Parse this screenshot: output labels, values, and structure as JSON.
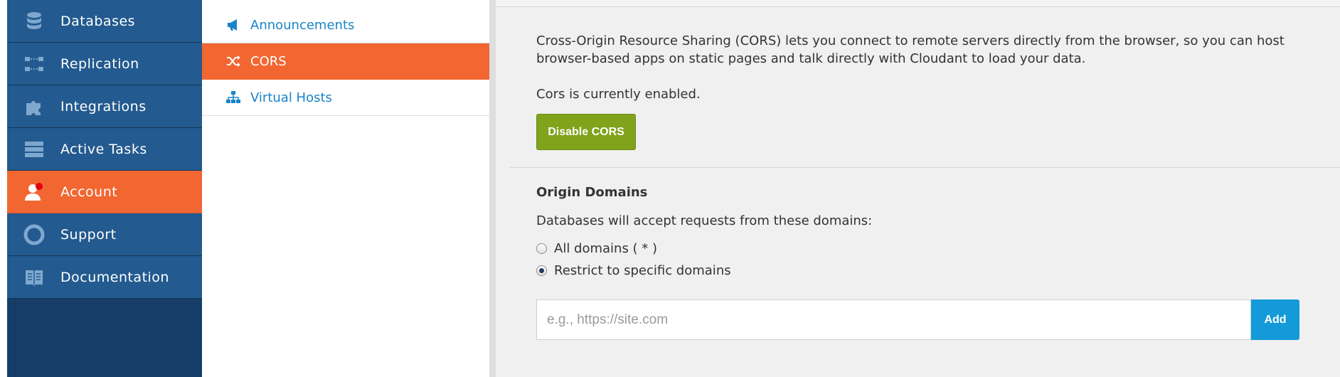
{
  "nav": {
    "items": [
      {
        "label": "Databases",
        "icon": "database-icon"
      },
      {
        "label": "Replication",
        "icon": "replication-icon"
      },
      {
        "label": "Integrations",
        "icon": "puzzle-icon"
      },
      {
        "label": "Active Tasks",
        "icon": "tasks-icon"
      },
      {
        "label": "Account",
        "icon": "user-icon",
        "active": true
      },
      {
        "label": "Support",
        "icon": "lifebuoy-icon"
      },
      {
        "label": "Documentation",
        "icon": "book-icon"
      }
    ]
  },
  "subnav": {
    "items": [
      {
        "label": "Announcements",
        "icon": "megaphone-icon"
      },
      {
        "label": "CORS",
        "icon": "shuffle-icon",
        "active": true
      },
      {
        "label": "Virtual Hosts",
        "icon": "sitemap-icon"
      }
    ]
  },
  "cors": {
    "description": "Cross-Origin Resource Sharing (CORS) lets you connect to remote servers directly from the browser, so you can host browser-based apps on static pages and talk directly with Cloudant to load your data.",
    "status": "Cors is currently enabled.",
    "disable_label": "Disable CORS",
    "origin_title": "Origin Domains",
    "origin_desc": "Databases will accept requests from these domains:",
    "options": [
      {
        "label": "All domains ( * )",
        "checked": false
      },
      {
        "label": "Restrict to specific domains",
        "checked": true
      }
    ],
    "domain_placeholder": "e.g., https://site.com",
    "domain_value": "",
    "add_label": "Add"
  },
  "colors": {
    "nav_bg": "#235a8f",
    "accent": "#f26631",
    "link": "#1a84c7",
    "green_button": "#7fa31b",
    "blue_button": "#149ad8"
  }
}
